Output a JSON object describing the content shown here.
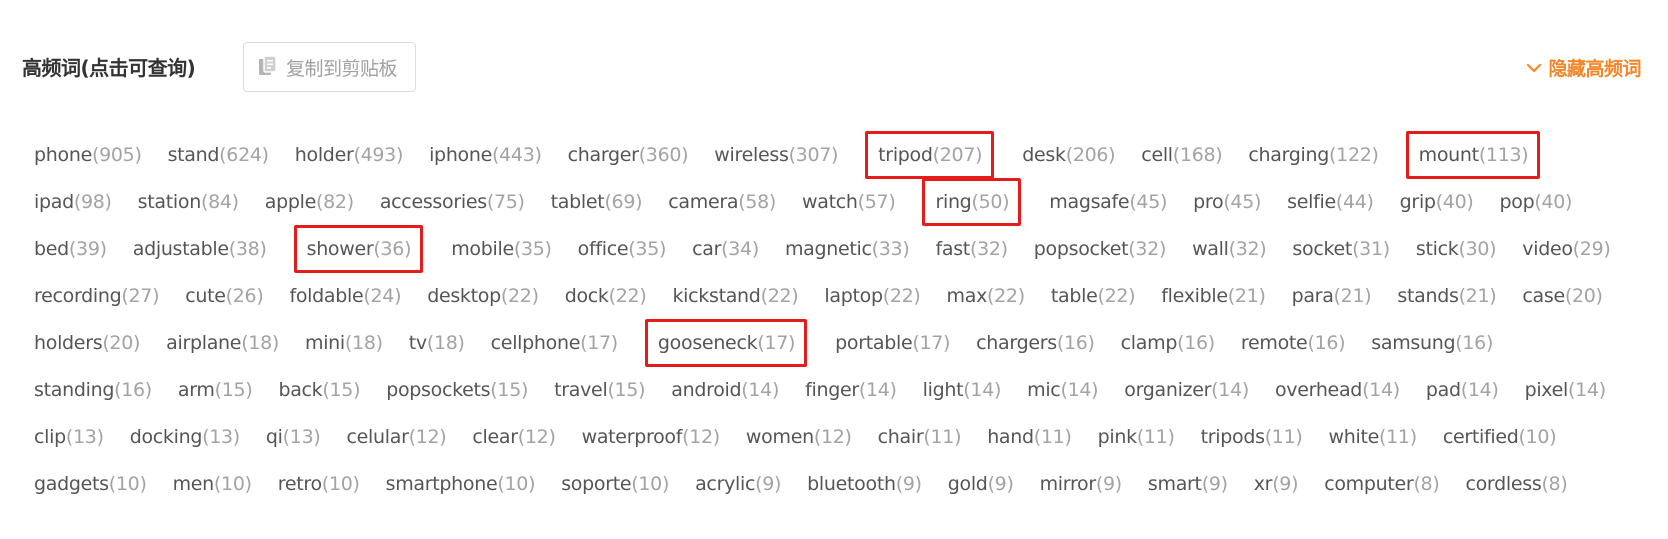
{
  "header": {
    "title": "高频词(点击可查询)",
    "copy_button": {
      "label": "复制到剪贴板",
      "icon": "copy-icon"
    },
    "toggle": {
      "label": "隐藏高频词",
      "icon": "chevron-down-icon"
    }
  },
  "colors": {
    "accent": "#f5862a",
    "highlight_border": "#e51c1c",
    "word_text": "#555555",
    "word_count": "#a3a3a3"
  },
  "keywords": [
    {
      "word": "phone",
      "count": "(905)",
      "highlighted": false
    },
    {
      "word": "stand",
      "count": "(624)",
      "highlighted": false
    },
    {
      "word": "holder",
      "count": "(493)",
      "highlighted": false
    },
    {
      "word": "iphone",
      "count": "(443)",
      "highlighted": false
    },
    {
      "word": "charger",
      "count": "(360)",
      "highlighted": false
    },
    {
      "word": "wireless",
      "count": "(307)",
      "highlighted": false
    },
    {
      "word": "tripod",
      "count": "(207)",
      "highlighted": true
    },
    {
      "word": "desk",
      "count": "(206)",
      "highlighted": false
    },
    {
      "word": "cell",
      "count": "(168)",
      "highlighted": false
    },
    {
      "word": "charging",
      "count": "(122)",
      "highlighted": false
    },
    {
      "word": "mount",
      "count": "(113)",
      "highlighted": true
    },
    {
      "word": "ipad",
      "count": "(98)",
      "highlighted": false
    },
    {
      "word": "station",
      "count": "(84)",
      "highlighted": false
    },
    {
      "word": "apple",
      "count": "(82)",
      "highlighted": false
    },
    {
      "word": "accessories",
      "count": "(75)",
      "highlighted": false
    },
    {
      "word": "tablet",
      "count": "(69)",
      "highlighted": false
    },
    {
      "word": "camera",
      "count": "(58)",
      "highlighted": false
    },
    {
      "word": "watch",
      "count": "(57)",
      "highlighted": false
    },
    {
      "word": "ring",
      "count": "(50)",
      "highlighted": true
    },
    {
      "word": "magsafe",
      "count": "(45)",
      "highlighted": false
    },
    {
      "word": "pro",
      "count": "(45)",
      "highlighted": false
    },
    {
      "word": "selfie",
      "count": "(44)",
      "highlighted": false
    },
    {
      "word": "grip",
      "count": "(40)",
      "highlighted": false
    },
    {
      "word": "pop",
      "count": "(40)",
      "highlighted": false
    },
    {
      "word": "bed",
      "count": "(39)",
      "highlighted": false
    },
    {
      "word": "adjustable",
      "count": "(38)",
      "highlighted": false
    },
    {
      "word": "shower",
      "count": "(36)",
      "highlighted": true
    },
    {
      "word": "mobile",
      "count": "(35)",
      "highlighted": false
    },
    {
      "word": "office",
      "count": "(35)",
      "highlighted": false
    },
    {
      "word": "car",
      "count": "(34)",
      "highlighted": false
    },
    {
      "word": "magnetic",
      "count": "(33)",
      "highlighted": false
    },
    {
      "word": "fast",
      "count": "(32)",
      "highlighted": false
    },
    {
      "word": "popsocket",
      "count": "(32)",
      "highlighted": false
    },
    {
      "word": "wall",
      "count": "(32)",
      "highlighted": false
    },
    {
      "word": "socket",
      "count": "(31)",
      "highlighted": false
    },
    {
      "word": "stick",
      "count": "(30)",
      "highlighted": false
    },
    {
      "word": "video",
      "count": "(29)",
      "highlighted": false
    },
    {
      "word": "recording",
      "count": "(27)",
      "highlighted": false
    },
    {
      "word": "cute",
      "count": "(26)",
      "highlighted": false
    },
    {
      "word": "foldable",
      "count": "(24)",
      "highlighted": false
    },
    {
      "word": "desktop",
      "count": "(22)",
      "highlighted": false
    },
    {
      "word": "dock",
      "count": "(22)",
      "highlighted": false
    },
    {
      "word": "kickstand",
      "count": "(22)",
      "highlighted": false
    },
    {
      "word": "laptop",
      "count": "(22)",
      "highlighted": false
    },
    {
      "word": "max",
      "count": "(22)",
      "highlighted": false
    },
    {
      "word": "table",
      "count": "(22)",
      "highlighted": false
    },
    {
      "word": "flexible",
      "count": "(21)",
      "highlighted": false
    },
    {
      "word": "para",
      "count": "(21)",
      "highlighted": false
    },
    {
      "word": "stands",
      "count": "(21)",
      "highlighted": false
    },
    {
      "word": "case",
      "count": "(20)",
      "highlighted": false
    },
    {
      "word": "holders",
      "count": "(20)",
      "highlighted": false
    },
    {
      "word": "airplane",
      "count": "(18)",
      "highlighted": false
    },
    {
      "word": "mini",
      "count": "(18)",
      "highlighted": false
    },
    {
      "word": "tv",
      "count": "(18)",
      "highlighted": false
    },
    {
      "word": "cellphone",
      "count": "(17)",
      "highlighted": false
    },
    {
      "word": "gooseneck",
      "count": "(17)",
      "highlighted": true
    },
    {
      "word": "portable",
      "count": "(17)",
      "highlighted": false
    },
    {
      "word": "chargers",
      "count": "(16)",
      "highlighted": false
    },
    {
      "word": "clamp",
      "count": "(16)",
      "highlighted": false
    },
    {
      "word": "remote",
      "count": "(16)",
      "highlighted": false
    },
    {
      "word": "samsung",
      "count": "(16)",
      "highlighted": false
    },
    {
      "word": "standing",
      "count": "(16)",
      "highlighted": false
    },
    {
      "word": "arm",
      "count": "(15)",
      "highlighted": false
    },
    {
      "word": "back",
      "count": "(15)",
      "highlighted": false
    },
    {
      "word": "popsockets",
      "count": "(15)",
      "highlighted": false
    },
    {
      "word": "travel",
      "count": "(15)",
      "highlighted": false
    },
    {
      "word": "android",
      "count": "(14)",
      "highlighted": false
    },
    {
      "word": "finger",
      "count": "(14)",
      "highlighted": false
    },
    {
      "word": "light",
      "count": "(14)",
      "highlighted": false
    },
    {
      "word": "mic",
      "count": "(14)",
      "highlighted": false
    },
    {
      "word": "organizer",
      "count": "(14)",
      "highlighted": false
    },
    {
      "word": "overhead",
      "count": "(14)",
      "highlighted": false
    },
    {
      "word": "pad",
      "count": "(14)",
      "highlighted": false
    },
    {
      "word": "pixel",
      "count": "(14)",
      "highlighted": false
    },
    {
      "word": "clip",
      "count": "(13)",
      "highlighted": false
    },
    {
      "word": "docking",
      "count": "(13)",
      "highlighted": false
    },
    {
      "word": "qi",
      "count": "(13)",
      "highlighted": false
    },
    {
      "word": "celular",
      "count": "(12)",
      "highlighted": false
    },
    {
      "word": "clear",
      "count": "(12)",
      "highlighted": false
    },
    {
      "word": "waterproof",
      "count": "(12)",
      "highlighted": false
    },
    {
      "word": "women",
      "count": "(12)",
      "highlighted": false
    },
    {
      "word": "chair",
      "count": "(11)",
      "highlighted": false
    },
    {
      "word": "hand",
      "count": "(11)",
      "highlighted": false
    },
    {
      "word": "pink",
      "count": "(11)",
      "highlighted": false
    },
    {
      "word": "tripods",
      "count": "(11)",
      "highlighted": false
    },
    {
      "word": "white",
      "count": "(11)",
      "highlighted": false
    },
    {
      "word": "certified",
      "count": "(10)",
      "highlighted": false
    },
    {
      "word": "gadgets",
      "count": "(10)",
      "highlighted": false
    },
    {
      "word": "men",
      "count": "(10)",
      "highlighted": false
    },
    {
      "word": "retro",
      "count": "(10)",
      "highlighted": false
    },
    {
      "word": "smartphone",
      "count": "(10)",
      "highlighted": false
    },
    {
      "word": "soporte",
      "count": "(10)",
      "highlighted": false
    },
    {
      "word": "acrylic",
      "count": "(9)",
      "highlighted": false
    },
    {
      "word": "bluetooth",
      "count": "(9)",
      "highlighted": false
    },
    {
      "word": "gold",
      "count": "(9)",
      "highlighted": false
    },
    {
      "word": "mirror",
      "count": "(9)",
      "highlighted": false
    },
    {
      "word": "smart",
      "count": "(9)",
      "highlighted": false
    },
    {
      "word": "xr",
      "count": "(9)",
      "highlighted": false
    },
    {
      "word": "computer",
      "count": "(8)",
      "highlighted": false
    },
    {
      "word": "cordless",
      "count": "(8)",
      "highlighted": false
    }
  ]
}
